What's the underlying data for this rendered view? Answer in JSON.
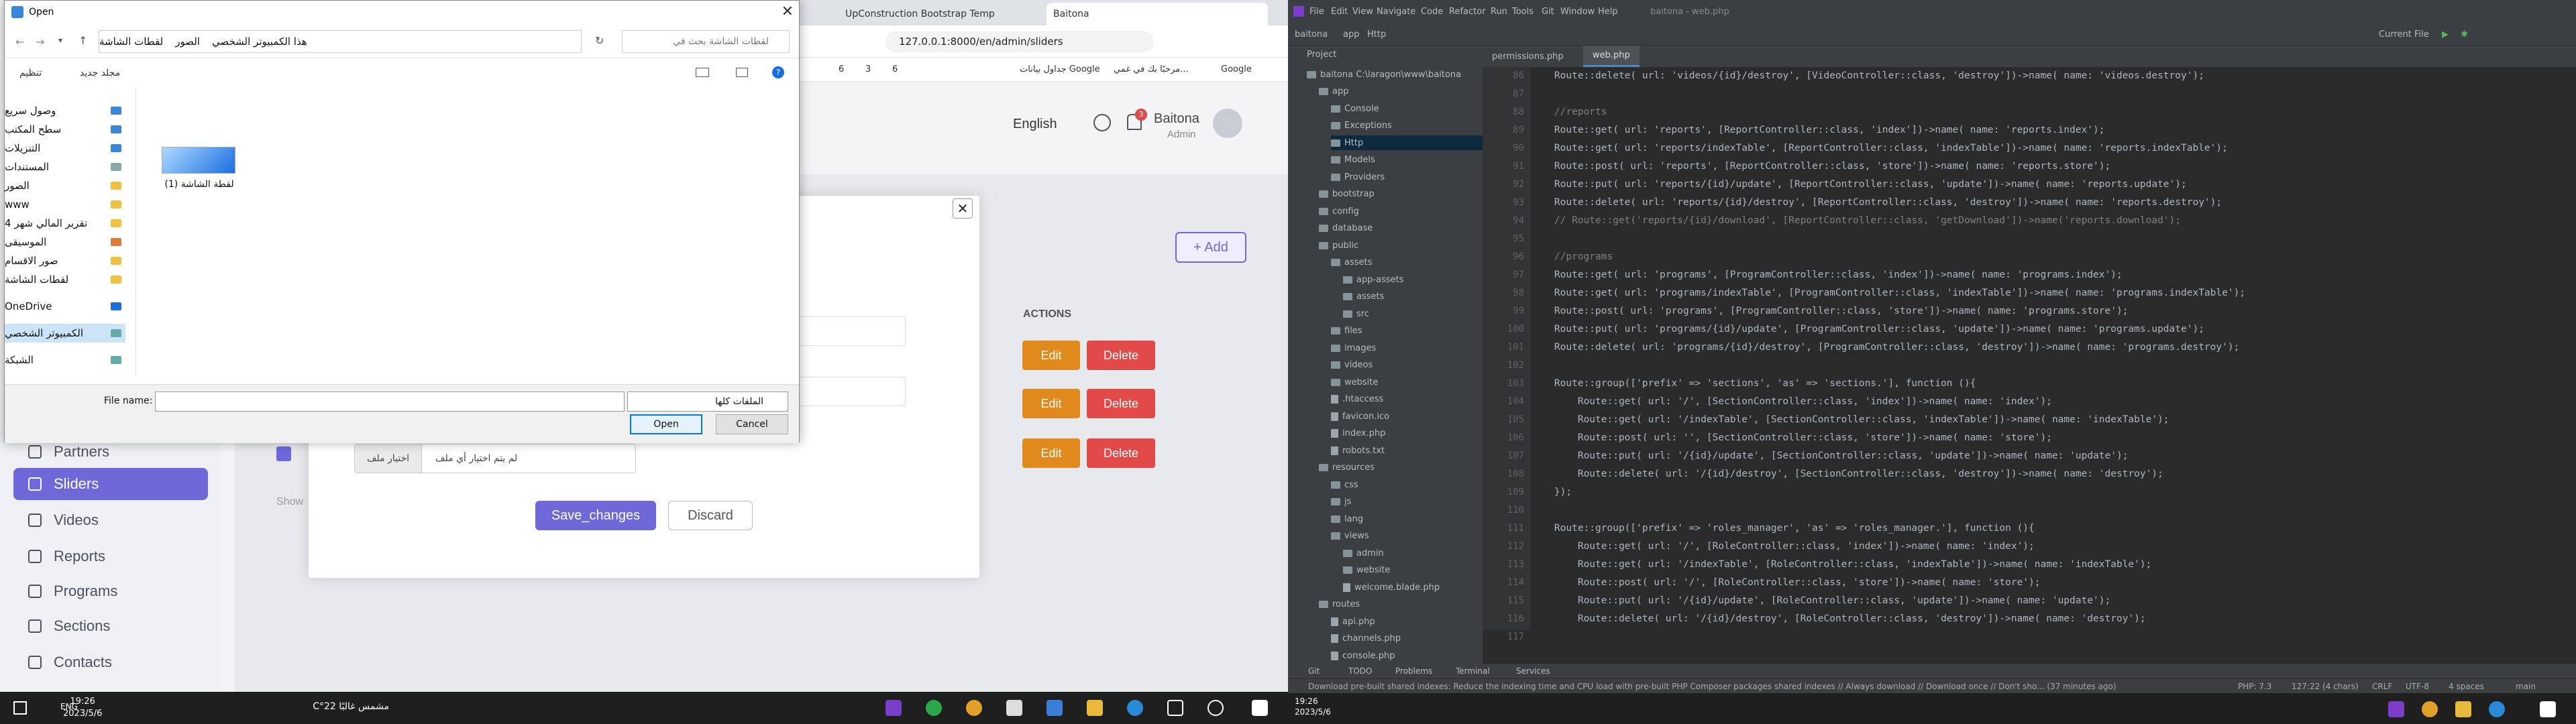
{
  "left": {
    "browser": {
      "tabs": [
        "UpConstruction Bootstrap Temp",
        "Baitona"
      ],
      "url": "127.0.0.1:8000/en/admin/sliders",
      "bookmarks": [
        "Google",
        "مرحبًا بك في غمي...",
        "جداول بيانات Google",
        "6",
        "3",
        "6"
      ]
    },
    "header": {
      "language": "English",
      "user_name": "Baitona",
      "user_role": "Admin",
      "notif_count": "3"
    },
    "sidebar": {
      "items": [
        "Partners",
        "Sliders",
        "Videos",
        "Reports",
        "Programs",
        "Sections",
        "Contacts"
      ],
      "active": "Sliders"
    },
    "content": {
      "add_button": "+ Add",
      "actions_header": "ACTIONS",
      "edit_label": "Edit",
      "delete_label": "Delete",
      "show_text": "Show"
    },
    "modal": {
      "close_symbol": "✕",
      "file_button": "اختيار ملف",
      "file_text": "لم يتم اختيار أي ملف",
      "save_label": "Save_changes",
      "discard_label": "Discard"
    },
    "dialog": {
      "title": "Open",
      "path": [
        "هذا الكمبيوتر الشخصي",
        "الصور",
        "لقطات الشاشة"
      ],
      "search_placeholder": "لقطات الشاشة بحث في",
      "organize": "تنظيم",
      "new_folder": "مجلد جديد",
      "tree": [
        "وصول سريع",
        "سطح المكتب",
        "التنزيلات",
        "المستندات",
        "الصور",
        "www",
        "تقرير المالي شهر 4",
        "الموسيقى",
        "صور الاقسام",
        "لقطات الشاشة",
        "OneDrive",
        "الكمبيوتر الشخصي",
        "الشبكة"
      ],
      "file_name_item": "لقطة الشاشة (1)",
      "file_name_label": "File name:",
      "file_type": "الملفات كلها",
      "open_label": "Open",
      "cancel_label": "Cancel"
    },
    "taskbar": {
      "time": "19:26",
      "date": "2023/5/6",
      "lang": "ENG",
      "weather": "مشمس غالبًا 22°C"
    }
  },
  "right": {
    "menu": [
      "File",
      "Edit",
      "View",
      "Navigate",
      "Code",
      "Refactor",
      "Run",
      "Tools",
      "Git",
      "Window",
      "Help"
    ],
    "window_title": "baitona - web.php",
    "breadcrumb": [
      "baitona",
      "app",
      "Http"
    ],
    "run_config": "Current File",
    "project_label": "Project",
    "tree": [
      {
        "name": "baitona  C:\\laragon\\www\\baitona",
        "depth": 0,
        "type": "folder"
      },
      {
        "name": "app",
        "depth": 1,
        "type": "folder"
      },
      {
        "name": "Console",
        "depth": 2,
        "type": "folder"
      },
      {
        "name": "Exceptions",
        "depth": 2,
        "type": "folder"
      },
      {
        "name": "Http",
        "depth": 2,
        "type": "folder",
        "selected": true
      },
      {
        "name": "Models",
        "depth": 2,
        "type": "folder"
      },
      {
        "name": "Providers",
        "depth": 2,
        "type": "folder"
      },
      {
        "name": "bootstrap",
        "depth": 1,
        "type": "folder"
      },
      {
        "name": "config",
        "depth": 1,
        "type": "folder"
      },
      {
        "name": "database",
        "depth": 1,
        "type": "folder"
      },
      {
        "name": "public",
        "depth": 1,
        "type": "folder"
      },
      {
        "name": "assets",
        "depth": 2,
        "type": "folder"
      },
      {
        "name": "app-assets",
        "depth": 3,
        "type": "folder"
      },
      {
        "name": "assets",
        "depth": 3,
        "type": "folder"
      },
      {
        "name": "src",
        "depth": 3,
        "type": "folder"
      },
      {
        "name": "files",
        "depth": 2,
        "type": "folder"
      },
      {
        "name": "images",
        "depth": 2,
        "type": "folder"
      },
      {
        "name": "videos",
        "depth": 2,
        "type": "folder"
      },
      {
        "name": "website",
        "depth": 2,
        "type": "folder"
      },
      {
        "name": ".htaccess",
        "depth": 2,
        "type": "file"
      },
      {
        "name": "favicon.ico",
        "depth": 2,
        "type": "file"
      },
      {
        "name": "index.php",
        "depth": 2,
        "type": "file"
      },
      {
        "name": "robots.txt",
        "depth": 2,
        "type": "file"
      },
      {
        "name": "resources",
        "depth": 1,
        "type": "folder"
      },
      {
        "name": "css",
        "depth": 2,
        "type": "folder"
      },
      {
        "name": "js",
        "depth": 2,
        "type": "folder"
      },
      {
        "name": "lang",
        "depth": 2,
        "type": "folder"
      },
      {
        "name": "views",
        "depth": 2,
        "type": "folder"
      },
      {
        "name": "admin",
        "depth": 3,
        "type": "folder"
      },
      {
        "name": "website",
        "depth": 3,
        "type": "folder"
      },
      {
        "name": "welcome.blade.php",
        "depth": 3,
        "type": "file"
      },
      {
        "name": "routes",
        "depth": 1,
        "type": "folder"
      },
      {
        "name": "api.php",
        "depth": 2,
        "type": "file"
      },
      {
        "name": "channels.php",
        "depth": 2,
        "type": "file"
      },
      {
        "name": "console.php",
        "depth": 2,
        "type": "file"
      }
    ],
    "editor_tabs": [
      "permissions.php",
      "web.php"
    ],
    "line_numbers": [
      "86",
      "87",
      "88",
      "89",
      "90",
      "91",
      "92",
      "93",
      "94",
      "95",
      "96",
      "97",
      "98",
      "99",
      "100",
      "101",
      "102",
      "103",
      "104",
      "105",
      "106",
      "107",
      "108",
      "109",
      "110",
      "111",
      "112",
      "113",
      "114",
      "115",
      "116",
      "117"
    ],
    "code_lines": [
      "    Route::delete( url: 'videos/{id}/destroy', [VideoController::class, 'destroy'])->name( name: 'videos.destroy');",
      "",
      "    //reports",
      "    Route::get( url: 'reports', [ReportController::class, 'index'])->name( name: 'reports.index');",
      "    Route::get( url: 'reports/indexTable', [ReportController::class, 'indexTable'])->name( name: 'reports.indexTable');",
      "    Route::post( url: 'reports', [ReportController::class, 'store'])->name( name: 'reports.store');",
      "    Route::put( url: 'reports/{id}/update', [ReportController::class, 'update'])->name( name: 'reports.update');",
      "    Route::delete( url: 'reports/{id}/destroy', [ReportController::class, 'destroy'])->name( name: 'reports.destroy');",
      "    // Route::get('reports/{id}/download', [ReportController::class, 'getDownload'])->name('reports.download');",
      "",
      "    //programs",
      "    Route::get( url: 'programs', [ProgramController::class, 'index'])->name( name: 'programs.index');",
      "    Route::get( url: 'programs/indexTable', [ProgramController::class, 'indexTable'])->name( name: 'programs.indexTable');",
      "    Route::post( url: 'programs', [ProgramController::class, 'store'])->name( name: 'programs.store');",
      "    Route::put( url: 'programs/{id}/update', [ProgramController::class, 'update'])->name( name: 'programs.update');",
      "    Route::delete( url: 'programs/{id}/destroy', [ProgramController::class, 'destroy'])->name( name: 'programs.destroy');",
      "",
      "    Route::group(['prefix' => 'sections', 'as' => 'sections.'], function (){",
      "        Route::get( url: '/', [SectionController::class, 'index'])->name( name: 'index');",
      "        Route::get( url: '/indexTable', [SectionController::class, 'indexTable'])->name( name: 'indexTable');",
      "        Route::post( url: '', [SectionController::class, 'store'])->name( name: 'store');",
      "        Route::put( url: '/{id}/update', [SectionController::class, 'update'])->name( name: 'update');",
      "        Route::delete( url: '/{id}/destroy', [SectionController::class, 'destroy'])->name( name: 'destroy');",
      "    });",
      "",
      "    Route::group(['prefix' => 'roles_manager', 'as' => 'roles_manager.'], function (){",
      "        Route::get( url: '/', [RoleController::class, 'index'])->name( name: 'index');",
      "        Route::get( url: '/indexTable', [RoleController::class, 'indexTable'])->name( name: 'indexTable');",
      "        Route::post( url: '/', [RoleController::class, 'store'])->name( name: 'store');",
      "        Route::put( url: '/{id}/update', [RoleController::class, 'update'])->name( name: 'update');",
      "        Route::delete( url: '/{id}/destroy', [RoleController::class, 'destroy'])->name( name: 'destroy');",
      "    });"
    ],
    "bottom_tools": [
      "Git",
      "TODO",
      "Problems",
      "Terminal",
      "Services"
    ],
    "status_message": "Download pre-built shared indexes: Reduce the indexing time and CPU load with pre-built PHP Composer packages shared indexes // Always download // Download once // Don't sho... (37 minutes ago)",
    "status_right": [
      "PHP: 7.3",
      "127:22 (4 chars)",
      "CRLF",
      "UTF-8",
      "4 spaces",
      "main"
    ],
    "taskbar": {
      "time": "19:26",
      "date": "2023/5/6"
    }
  }
}
